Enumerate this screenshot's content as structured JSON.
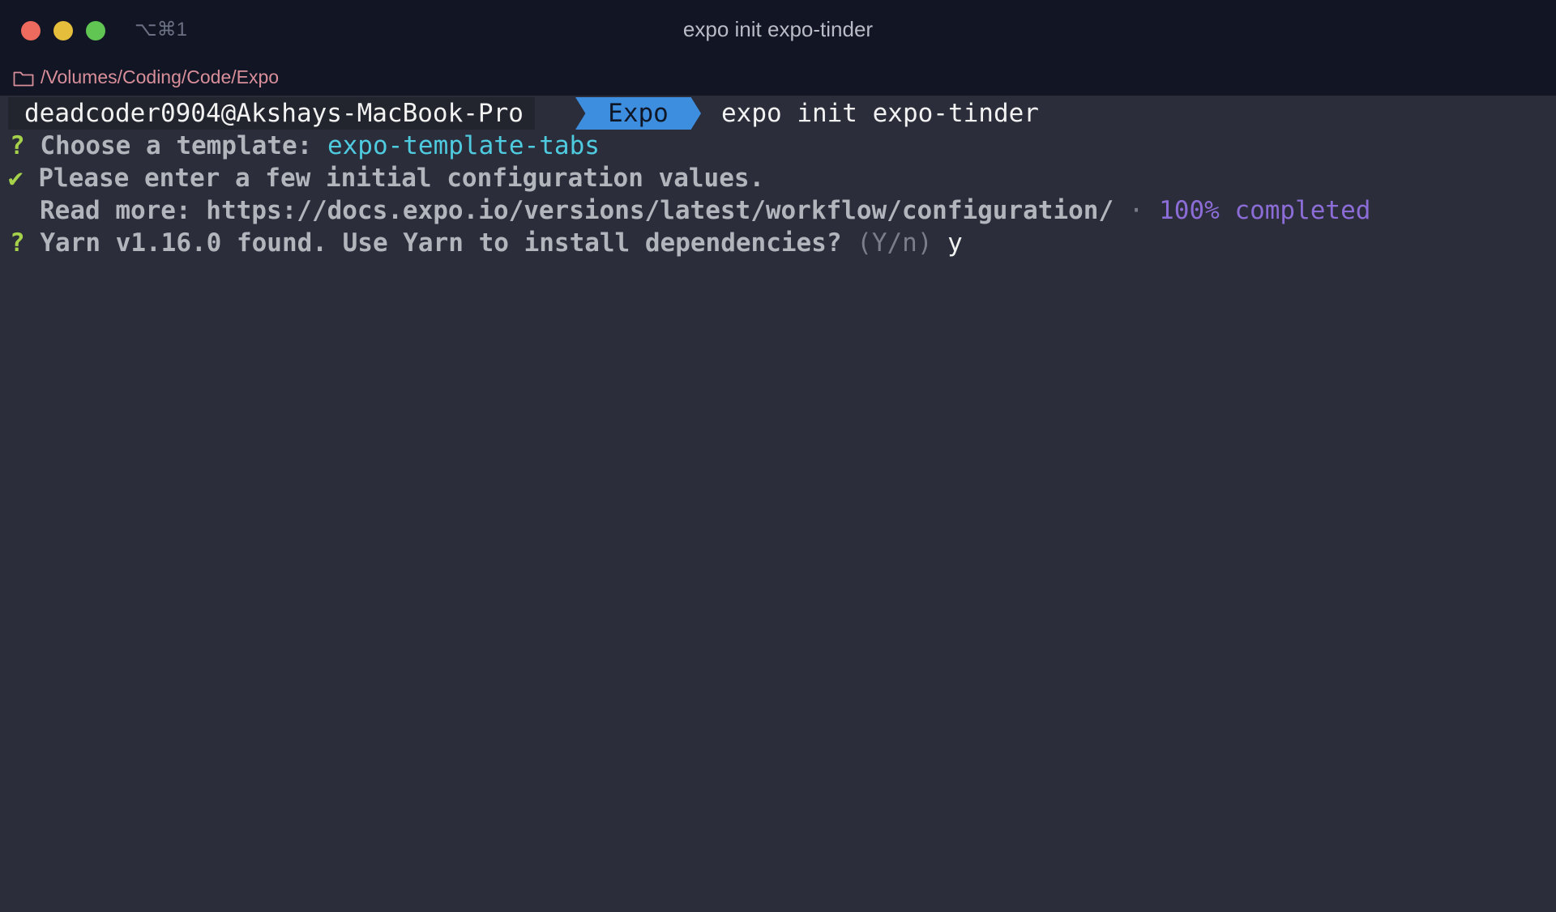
{
  "window": {
    "shortcut": "⌥⌘1",
    "title": "expo init expo-tinder",
    "path": "/Volumes/Coding/Code/Expo"
  },
  "prompt": {
    "user": "deadcoder0904@Akshays-MacBook-Pro",
    "dir": "Expo",
    "command": "expo init expo-tinder"
  },
  "lines": {
    "template_mark": "?",
    "template_label": "Choose a template: ",
    "template_value": "expo-template-tabs",
    "config_mark": "✔",
    "config_text": "Please enter a few initial configuration values.",
    "readmore_text": "Read more: https://docs.expo.io/versions/latest/workflow/configuration/",
    "readmore_sep": " · ",
    "readmore_progress": "100% completed",
    "yarn_mark": "?",
    "yarn_text": "Yarn v1.16.0 found. Use Yarn to install dependencies? ",
    "yarn_hint": "(Y/n)",
    "yarn_answer": " y"
  },
  "colors": {
    "background": "#2b2e3a",
    "titlebar": "#111524",
    "prompt_dir_bg": "#3e8ee0",
    "accent_green": "#a6d14a",
    "accent_cyan": "#4fcbe0",
    "accent_purple": "#8c6cd6"
  }
}
